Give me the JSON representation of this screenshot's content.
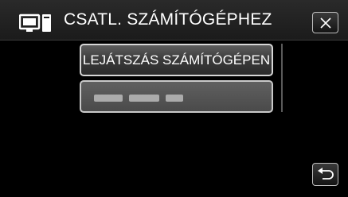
{
  "header": {
    "title": "CSATL. SZÁMÍTÓGÉPHEZ",
    "icon": "pc-connection-icon",
    "close_icon": "close-icon"
  },
  "menu": {
    "items": [
      {
        "label": "LEJÁTSZÁS SZÁMÍTÓGÉPEN",
        "state": "normal"
      },
      {
        "label": "",
        "state": "disabled-blurred"
      }
    ]
  },
  "footer": {
    "back_icon": "return-icon"
  }
}
